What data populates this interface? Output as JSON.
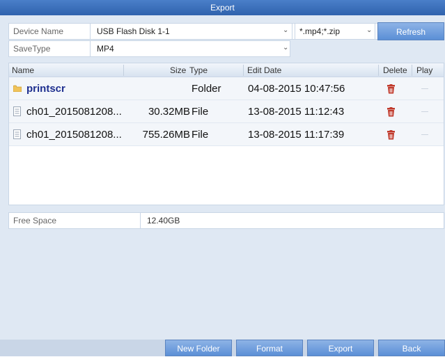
{
  "window": {
    "title": "Export"
  },
  "filters": {
    "device_label": "Device Name",
    "device_value": "USB Flash Disk 1-1",
    "filetype_value": "*.mp4;*.zip",
    "refresh_label": "Refresh",
    "savetype_label": "SaveType",
    "savetype_value": "MP4"
  },
  "table": {
    "columns": [
      "Name",
      "Size",
      "Type",
      "Edit Date",
      "Delete",
      "Play"
    ],
    "rows": [
      {
        "name": "printscr",
        "size": "",
        "type": "Folder",
        "date": "04-08-2015 10:47:56",
        "icon": "folder-icon"
      },
      {
        "name": "ch01_2015081208...",
        "size": "30.32MB",
        "type": "File",
        "date": "13-08-2015 11:12:43",
        "icon": "file-icon"
      },
      {
        "name": "ch01_2015081208...",
        "size": "755.26MB",
        "type": "File",
        "date": "13-08-2015 11:17:39",
        "icon": "file-icon"
      }
    ]
  },
  "free_space": {
    "label": "Free Space",
    "value": "12.40GB"
  },
  "buttons": {
    "new_folder": "New Folder",
    "format": "Format",
    "export": "Export",
    "back": "Back"
  },
  "colors": {
    "title_bar": "#2f62ad",
    "button": "#6f9ddc",
    "delete_icon": "#c0392b",
    "folder_text": "#1e2f8f"
  }
}
